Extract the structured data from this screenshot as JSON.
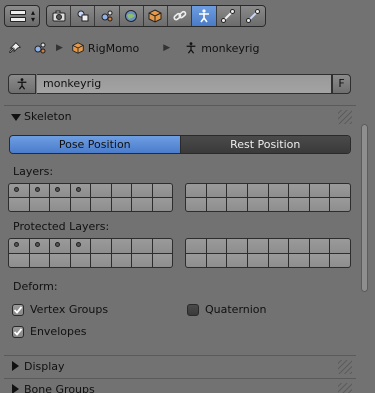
{
  "header": {
    "tabs": [
      {
        "name": "render-tab",
        "icon": "camera-icon",
        "active": false
      },
      {
        "name": "render-layers-tab",
        "icon": "layers-icon",
        "active": false
      },
      {
        "name": "scene-tab",
        "icon": "scene-icon",
        "active": false
      },
      {
        "name": "world-tab",
        "icon": "world-icon",
        "active": false
      },
      {
        "name": "object-tab",
        "icon": "cube-icon",
        "active": false
      },
      {
        "name": "constraints-tab",
        "icon": "chain-icon",
        "active": false
      },
      {
        "name": "armature-data-tab",
        "icon": "armature-icon",
        "active": true
      },
      {
        "name": "bone-tab",
        "icon": "bone-icon",
        "active": false
      },
      {
        "name": "bone-constraints-tab",
        "icon": "bone-constraint-icon",
        "active": false
      }
    ]
  },
  "breadcrumb": {
    "object": "RigMomo",
    "data": "monkeyrig"
  },
  "name_field": {
    "value": "monkeyrig",
    "fake_user": "F"
  },
  "skeleton": {
    "title": "Skeleton",
    "pose_position": "Pose Position",
    "rest_position": "Rest Position",
    "active_mode": "Pose Position",
    "layers_label": "Layers:",
    "protected_layers_label": "Protected Layers:",
    "layers_marked": [
      0,
      1,
      2,
      3
    ],
    "protected_marked": [
      0,
      1,
      2,
      3
    ],
    "deform_label": "Deform:",
    "vertex_groups": {
      "label": "Vertex Groups",
      "checked": true
    },
    "envelopes": {
      "label": "Envelopes",
      "checked": true
    },
    "quaternion": {
      "label": "Quaternion",
      "checked": false
    }
  },
  "panels": {
    "display": "Display",
    "bone_groups": "Bone Groups"
  },
  "colors": {
    "background": "#727272",
    "active_blue": "#5689d6",
    "dark_button": "#424242"
  }
}
